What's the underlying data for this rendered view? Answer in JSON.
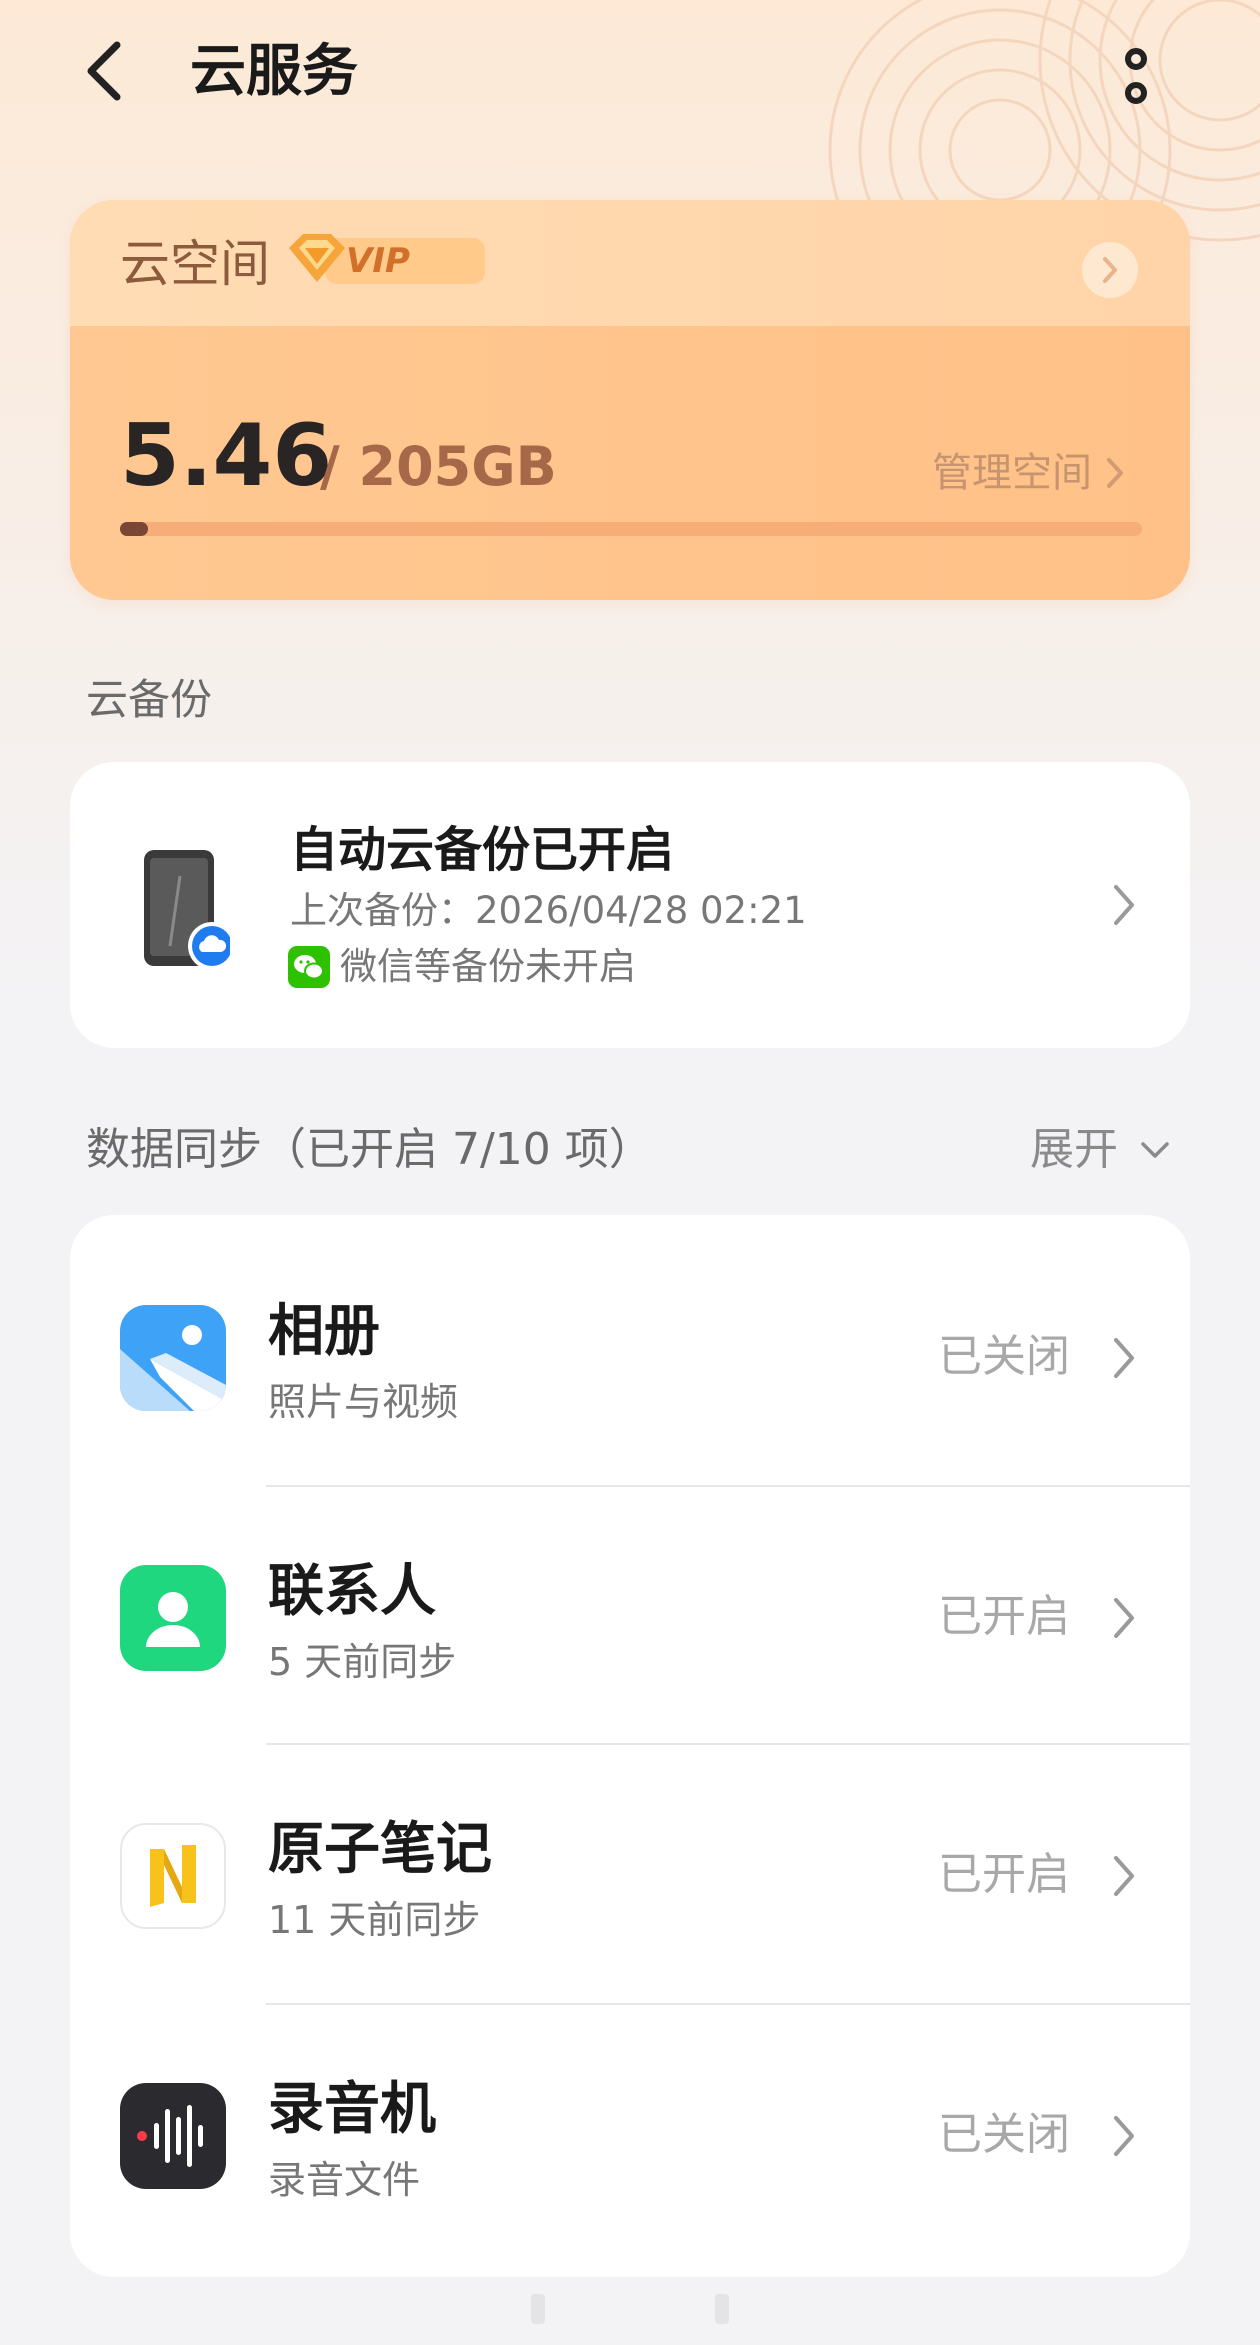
{
  "header": {
    "title": "云服务"
  },
  "cloud_space": {
    "label": "云空间",
    "badge": "VIP",
    "used": "5.46",
    "total": "/ 205GB",
    "manage_label": "管理空间",
    "usage_fraction": 0.027
  },
  "backup": {
    "section_title": "云备份",
    "title": "自动云备份已开启",
    "last_backup": "上次备份：2026/04/28 02:21",
    "wechat_note": "微信等备份未开启"
  },
  "sync": {
    "section_title": "数据同步（已开启 7/10 项）",
    "expand_label": "展开",
    "items": [
      {
        "name": "相册",
        "sub": "照片与视频",
        "status": "已关闭",
        "icon": "photos-icon"
      },
      {
        "name": "联系人",
        "sub": "5 天前同步",
        "status": "已开启",
        "icon": "contacts-icon"
      },
      {
        "name": "原子笔记",
        "sub": "11 天前同步",
        "status": "已开启",
        "icon": "notes-icon"
      },
      {
        "name": "录音机",
        "sub": "录音文件",
        "status": "已关闭",
        "icon": "recorder-icon"
      }
    ]
  },
  "colors": {
    "accent_brown": "#8c5a3c",
    "vip_orange": "#ffc187",
    "status_gray": "#a8a8a8",
    "contacts_green": "#1ed77f",
    "wechat_green": "#2dc100"
  }
}
